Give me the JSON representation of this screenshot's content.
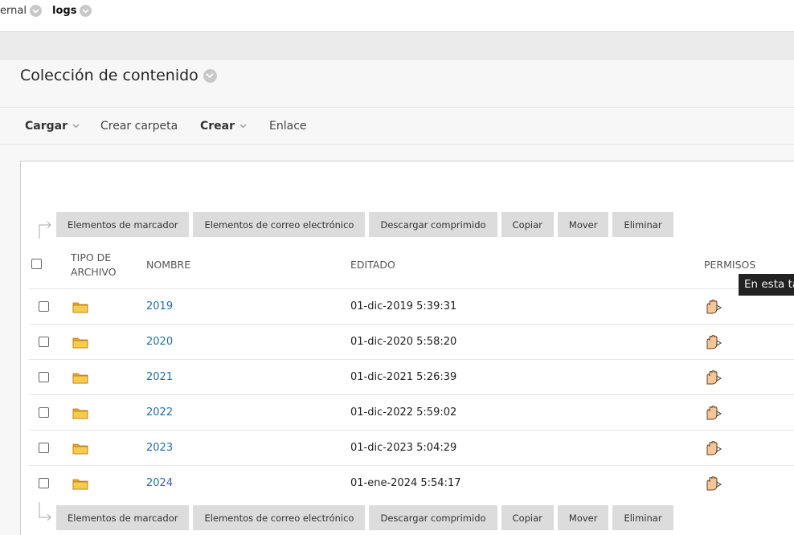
{
  "breadcrumb": {
    "items": [
      {
        "label": "ernal"
      },
      {
        "label": "logs"
      }
    ]
  },
  "page": {
    "title": "Colección de contenido"
  },
  "actions": {
    "upload": "Cargar",
    "create_folder": "Crear carpeta",
    "create": "Crear",
    "link": "Enlace"
  },
  "toolbar": {
    "buttons": [
      "Elementos de marcador",
      "Elementos de correo electrónico",
      "Descargar comprimido",
      "Copiar",
      "Mover",
      "Eliminar"
    ]
  },
  "table": {
    "headers": {
      "type_line1": "TIPO DE",
      "type_line2": "ARCHIVO",
      "name": "NOMBRE",
      "edited": "EDITADO",
      "permissions": "PERMISOS"
    },
    "rows": [
      {
        "name": "2019",
        "edited": "01-dic-2019 5:39:31"
      },
      {
        "name": "2020",
        "edited": "01-dic-2020 5:58:20"
      },
      {
        "name": "2021",
        "edited": "01-dic-2021 5:26:39"
      },
      {
        "name": "2022",
        "edited": "01-dic-2022 5:59:02"
      },
      {
        "name": "2023",
        "edited": "01-dic-2023 5:04:29"
      },
      {
        "name": "2024",
        "edited": "01-ene-2024 5:54:17"
      }
    ]
  },
  "tooltip": {
    "text": "En esta ta"
  },
  "icons": {
    "folder": "folder-icon",
    "permissions": "hand-permissions-icon",
    "chevron": "chevron-down-icon"
  }
}
